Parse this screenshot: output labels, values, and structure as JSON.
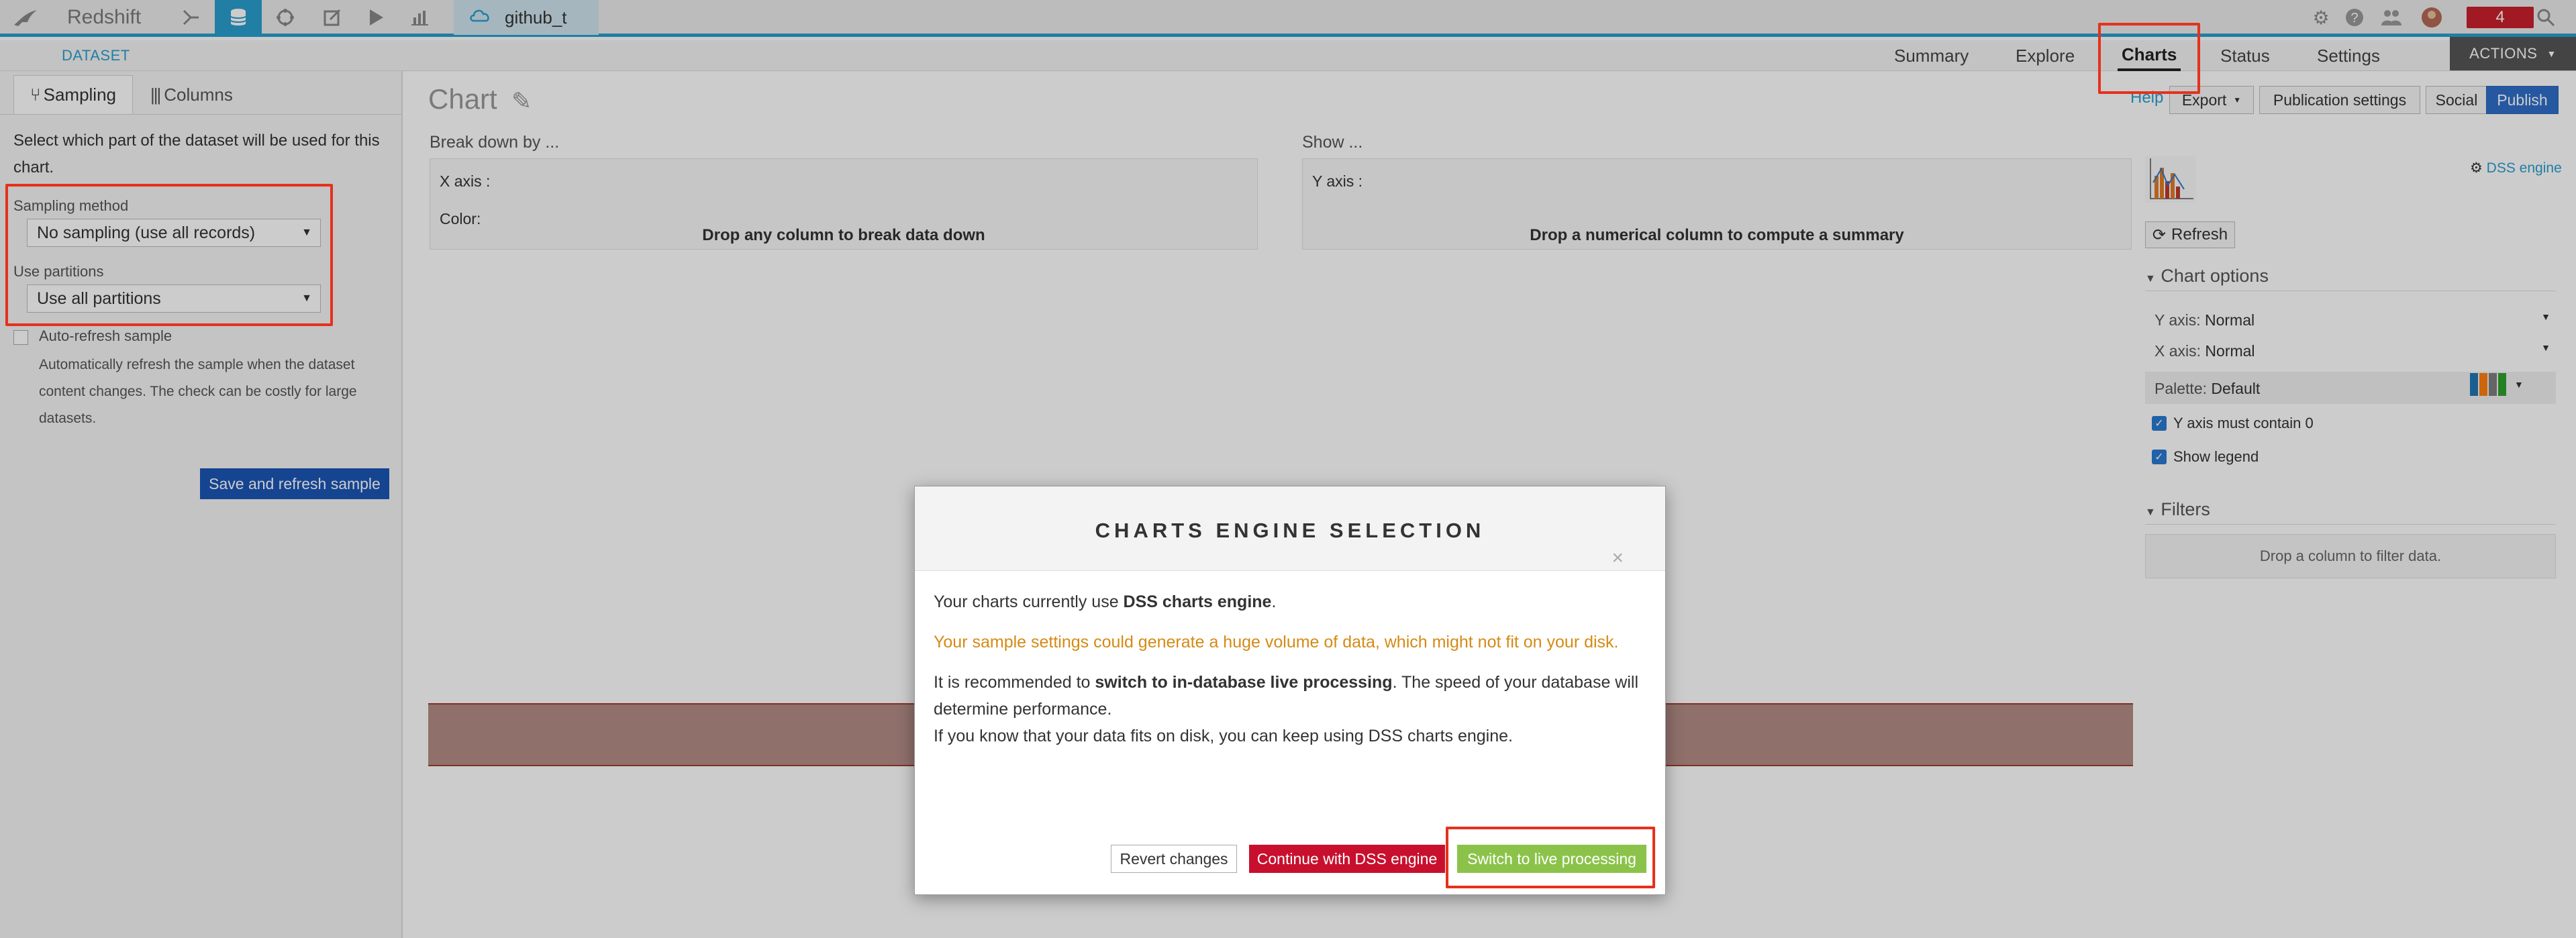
{
  "topbar": {
    "project": "Redshift",
    "dataset_tab": "github_t",
    "notification_count": "4"
  },
  "subbar": {
    "crumb": "DATASET",
    "tabs": [
      "Summary",
      "Explore",
      "Charts",
      "Status",
      "Settings"
    ],
    "actions": "ACTIONS"
  },
  "left": {
    "tab_sampling": "Sampling",
    "tab_columns": "Columns",
    "intro": "Select which part of the dataset will be used for this chart.",
    "sampling_method_label": "Sampling method",
    "sampling_method_value": "No sampling (use all records)",
    "use_partitions_label": "Use partitions",
    "use_partitions_value": "Use all partitions",
    "auto_refresh_label": "Auto-refresh sample",
    "auto_refresh_help": "Automatically refresh the sample when the dataset content changes. The check can be costly for large datasets.",
    "save_button": "Save and refresh sample"
  },
  "main": {
    "title": "Chart",
    "help": "Help",
    "export": "Export",
    "publication_settings": "Publication settings",
    "social": "Social",
    "publish": "Publish",
    "breakdown_head": "Break down by ...",
    "x_axis": "X axis :",
    "color": "Color:",
    "breakdown_drop": "Drop any column to break data down",
    "show_head": "Show ...",
    "y_axis": "Y axis :",
    "show_drop": "Drop a numerical column to compute a summary"
  },
  "right": {
    "dss_engine": "DSS engine",
    "refresh": "Refresh",
    "chart_options": "Chart options",
    "y_axis_label": "Y axis:",
    "y_axis_value": "Normal",
    "x_axis_label": "X axis:",
    "x_axis_value": "Normal",
    "palette_label": "Palette:",
    "palette_value": "Default",
    "palette_colors": [
      "#1f77b4",
      "#ff7f0e",
      "#2ca02c"
    ],
    "y_zero": "Y axis must contain 0",
    "show_legend": "Show legend",
    "filters": "Filters",
    "filter_drop": "Drop a column to filter data."
  },
  "modal": {
    "title": "CHARTS ENGINE SELECTION",
    "close": "×",
    "line1_prefix": "Your charts currently use ",
    "line1_bold": "DSS charts engine",
    "line1_suffix": ".",
    "warning": "Your sample settings could generate a huge volume of data, which might not fit on your disk.",
    "rec_prefix": "It is recommended to ",
    "rec_bold": "switch to in-database live processing",
    "rec_suffix": ". The speed of your database will determine performance.",
    "line4": "If you know that your data fits on disk, you can keep using DSS charts engine.",
    "revert": "Revert changes",
    "continue": "Continue with DSS engine",
    "switch": "Switch to live processing"
  },
  "colors": {
    "accent": "#2a9ecf",
    "highlight": "#e5311c",
    "publish": "#2f6ec9",
    "continue": "#c8102e",
    "switch": "#8bc34a",
    "warning": "#d58a15"
  }
}
